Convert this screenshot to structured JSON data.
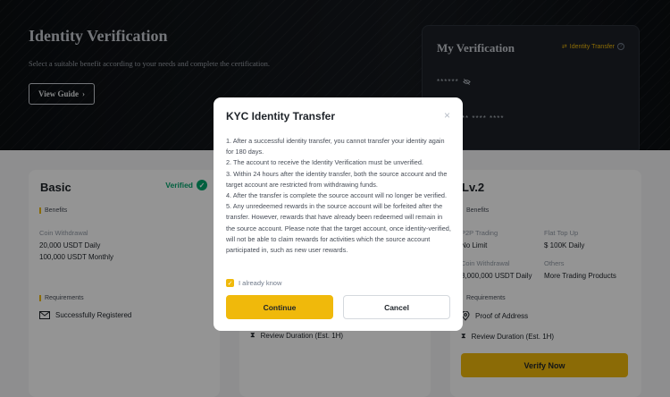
{
  "hero": {
    "title": "Identity Verification",
    "subtitle": "Select a suitable benefit according to your needs and complete the certification.",
    "guide_button": "View Guide",
    "guide_chevron": "›"
  },
  "my_verification": {
    "title": "My Verification",
    "transfer_link": "Identity Transfer",
    "masked_name": "******",
    "masked_id": "** ****** **** ****"
  },
  "cards": {
    "basic": {
      "title": "Basic",
      "status": "Verified",
      "benefits_label": "Benefits",
      "coin_withdrawal_label": "Coin Withdrawal",
      "coin_withdrawal_values": [
        "20,000 USDT Daily",
        "100,000 USDT Monthly"
      ],
      "requirements_label": "Requirements",
      "requirement": "Successfully Registered"
    },
    "middle": {
      "review": "Review Duration (Est. 1H)"
    },
    "lv2": {
      "title": "Lv.2",
      "benefits_label": "Benefits",
      "p2p_label": "P2P Trading",
      "p2p_value": "No Limit",
      "flat_label": "Flat Top Up",
      "flat_value": "$ 100K Daily",
      "coin_label": "Coin Withdrawal",
      "coin_value": "8,000,000 USDT Daily",
      "others_label": "Others",
      "others_value": "More Trading Products",
      "requirements_label": "Requirements",
      "req_address": "Proof of Address",
      "req_review": "Review Duration (Est. 1H)",
      "verify_button": "Verify Now"
    }
  },
  "modal": {
    "title": "KYC Identity Transfer",
    "close": "×",
    "items": [
      "1. After a successful identity transfer, you cannot transfer your identity again for 180 days.",
      "2. The account to receive the Identity Verification must be unverified.",
      "3. Within 24 hours after the identity transfer, both the source account and the target account are restricted from withdrawing funds.",
      "4. After the transfer is complete the source account will no longer be verified.",
      "5. Any unredeemed rewards in the source account will be forfeited after the transfer. However, rewards that have already been redeemed will remain in the source account. Please note that the target account, once identity-verified, will not be able to claim rewards for activities which the source account participated in, such as new user rewards."
    ],
    "checkbox_label": "I already know",
    "continue_label": "Continue",
    "cancel_label": "Cancel"
  },
  "colors": {
    "accent": "#f0b90b",
    "success": "#03a66d",
    "hero_bg": "#0b0e11"
  }
}
